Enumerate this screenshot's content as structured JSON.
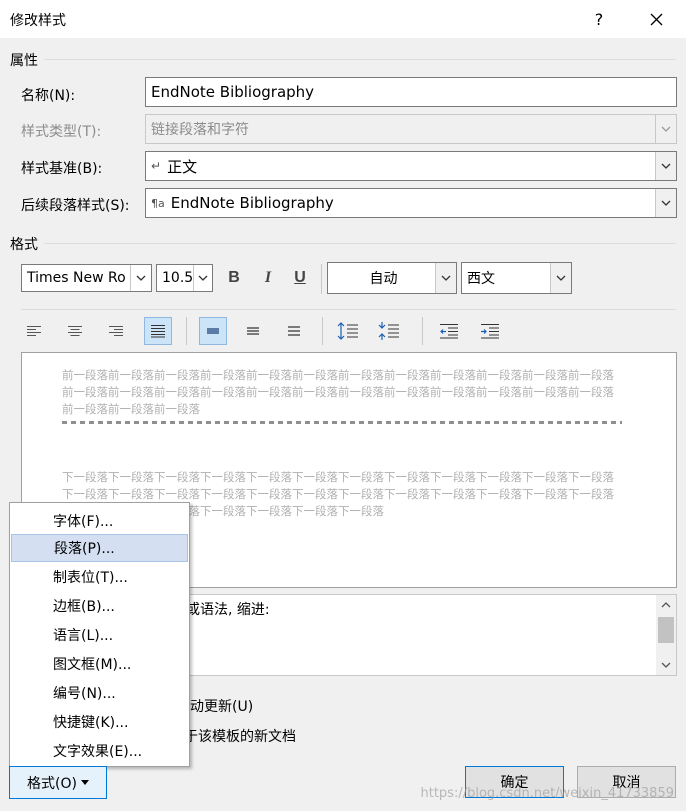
{
  "window": {
    "title": "修改样式",
    "help_glyph": "?",
    "close_glyph": "✕"
  },
  "properties": {
    "section_title": "属性",
    "name": {
      "label": "名称(N):",
      "value": "EndNote Bibliography"
    },
    "style_type": {
      "label": "样式类型(T):",
      "value": "链接段落和字符"
    },
    "based_on": {
      "label": "样式基准(B):",
      "glyph": "↵",
      "value": "正文"
    },
    "following": {
      "label": "后续段落样式(S):",
      "glyph": "¶a",
      "value": "EndNote Bibliography"
    }
  },
  "format": {
    "section_title": "格式",
    "font_name": "Times New Ro",
    "font_size": "10.5",
    "bold": "B",
    "italic": "I",
    "underline": "U",
    "color": "自动",
    "script": "西文"
  },
  "preview": {
    "before": "前一段落前一段落前一段落前一段落前一段落前一段落前一段落前一段落前一段落前一段落前一段落前一段落前一段落前一段落前一段落前一段落前一段落前一段落前一段落前一段落前一段落前一段落前一段落前一段落前一段落前一段落前一段落",
    "after": "下一段落下一段落下一段落下一段落下一段落下一段落下一段落下一段落下一段落下一段落下一段落下一段落下一段落下一段落下一段落下一段落下一段落下一段落下一段落下一段落下一段落下一段落下一段落下一段落下一段落下一段落下一段落下一段落下一段落下一段落下一段落"
  },
  "description": {
    "visible": "吾或语法, 缩进:"
  },
  "options": {
    "auto_update": "动更新(U)",
    "template": "于该模板的新文档"
  },
  "menu": {
    "items": [
      "字体(F)...",
      "段落(P)...",
      "制表位(T)...",
      "边框(B)...",
      "语言(L)...",
      "图文框(M)...",
      "编号(N)...",
      "快捷键(K)...",
      "文字效果(E)..."
    ],
    "highlighted_index": 1
  },
  "buttons": {
    "format": "格式(O)",
    "ok": "确定",
    "cancel": "取消"
  },
  "watermark": "https://blog.csdn.net/weixin_41733859"
}
